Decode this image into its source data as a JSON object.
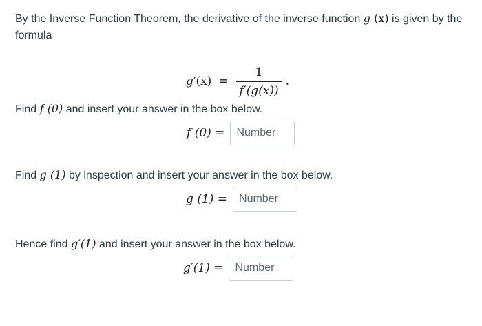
{
  "intro": {
    "text_before": "By the Inverse Function Theorem, the derivative of the inverse function ",
    "function_name": "g",
    "function_arg": "(x)",
    "text_after": " is given by the formula"
  },
  "formula": {
    "lhs_fn": "g",
    "lhs_prime": "′",
    "lhs_arg": "(x)",
    "equals": "=",
    "numerator": "1",
    "denominator": "f′(g(x))",
    "trailing": "."
  },
  "questions": [
    {
      "prompt_before": "Find ",
      "prompt_math": "f (0)",
      "prompt_after": " and insert your answer in the box below.",
      "lhs": "f (0) =",
      "placeholder": "Number"
    },
    {
      "prompt_before": "Find ",
      "prompt_math": "g (1)",
      "prompt_after": " by inspection and insert your answer in the box below.",
      "lhs": "g (1) =",
      "placeholder": "Number"
    },
    {
      "prompt_before": "Hence find ",
      "prompt_math": "g′(1)",
      "prompt_after": " and insert your answer in the box below.",
      "lhs": "g′(1) =",
      "placeholder": "Number"
    }
  ]
}
